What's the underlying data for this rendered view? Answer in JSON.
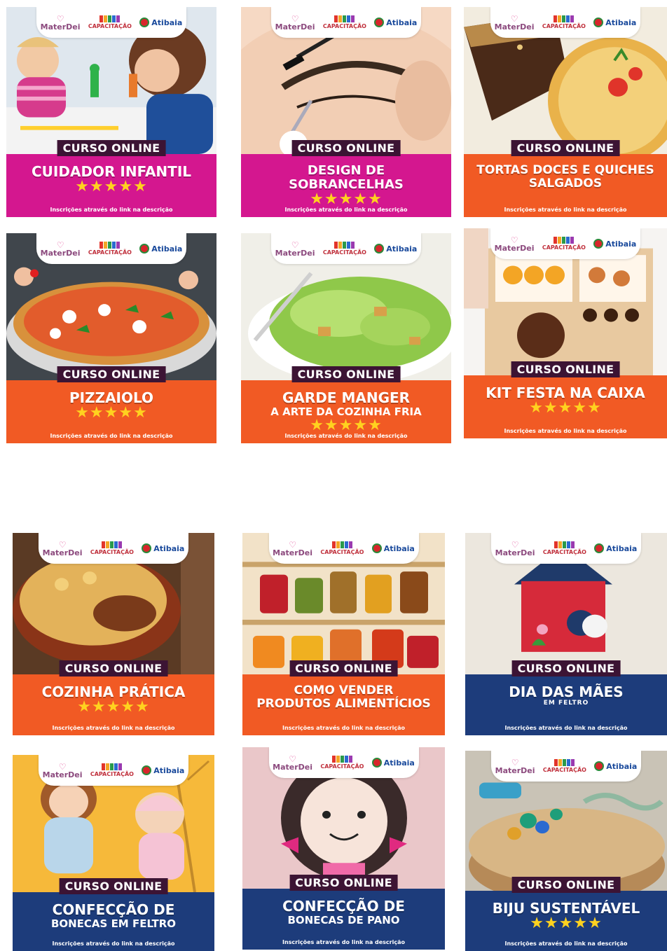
{
  "colors": {
    "magenta": "#d4178f",
    "orange": "#f15a24",
    "navy": "#1d3c7b",
    "badge": "#3c1434",
    "star": "#ffd21f"
  },
  "logos": {
    "materdei": "MaterDei",
    "capacitacao": "CAPACITAÇÃO",
    "atibaia": "Atibaia"
  },
  "cards": [
    {
      "badge": "CURSO ONLINE",
      "title": "CUIDADOR INFANTIL",
      "subtitle": "",
      "stars": "★★★★★",
      "footer": "Inscrições através do link na descrição",
      "color": "#d4178f",
      "scene": "babysitter"
    },
    {
      "badge": "CURSO ONLINE",
      "title": "DESIGN DE SOBRANCELHAS",
      "subtitle": "",
      "stars": "★★★★★",
      "footer": "Inscrições através do link na descrição",
      "color": "#d4178f",
      "scene": "eyebrow"
    },
    {
      "badge": "CURSO ONLINE",
      "title": "TORTAS DOCES E QUICHES SALGADOS",
      "subtitle": "",
      "stars": "",
      "footer": "Inscrições através do link na descrição",
      "color": "#f15a24",
      "scene": "pie"
    },
    {
      "badge": "CURSO ONLINE",
      "title": "PIZZAIOLO",
      "subtitle": "",
      "stars": "★★★★★",
      "footer": "Inscrições através do link na descrição",
      "color": "#f15a24",
      "scene": "pizza"
    },
    {
      "badge": "CURSO ONLINE",
      "title": "GARDE MANGER",
      "subtitle": "A ARTE DA COZINHA FRIA",
      "stars": "★★★★★",
      "footer": "Inscrições através do link na descrição",
      "color": "#f15a24",
      "scene": "salad"
    },
    {
      "badge": "CURSO ONLINE",
      "title": "KIT FESTA NA CAIXA",
      "subtitle": "",
      "stars": "★★★★★",
      "footer": "Inscrições através do link na descrição",
      "color": "#f15a24",
      "scene": "box"
    },
    {
      "badge": "CURSO ONLINE",
      "title": "COZINHA PRÁTICA",
      "subtitle": "",
      "stars": "★★★★★",
      "footer": "Inscrições através do link na descrição",
      "color": "#f15a24",
      "scene": "casserole"
    },
    {
      "badge": "CURSO ONLINE",
      "title": "COMO VENDER PRODUTOS ALIMENTÍCIOS",
      "subtitle": "",
      "stars": "",
      "footer": "Inscrições através do link na descrição",
      "color": "#f15a24",
      "scene": "jars"
    },
    {
      "badge": "CURSO ONLINE",
      "title": "DIA DAS MÃES",
      "subtitle": "EM FELTRO",
      "stars": "",
      "footer": "Inscrições através do link na descrição",
      "color": "#1d3c7b",
      "scene": "felthouse"
    },
    {
      "badge": "CURSO ONLINE",
      "title": "CONFECÇÃO DE",
      "subtitle": "BONECAS EM FELTRO",
      "stars": "",
      "footer": "Inscrições através do link na descrição",
      "color": "#1d3c7b",
      "scene": "dolls"
    },
    {
      "badge": "CURSO ONLINE",
      "title": "CONFECÇÃO DE",
      "subtitle": "BONECAS DE PANO",
      "stars": "",
      "footer": "Inscrições através do link na descrição",
      "color": "#1d3c7b",
      "scene": "ragdoll"
    },
    {
      "badge": "CURSO ONLINE",
      "title": "BIJU SUSTENTÁVEL",
      "subtitle": "",
      "stars": "★★★★★",
      "footer": "Inscrições através do link na descrição",
      "color": "#1d3c7b",
      "scene": "jewelry"
    }
  ]
}
